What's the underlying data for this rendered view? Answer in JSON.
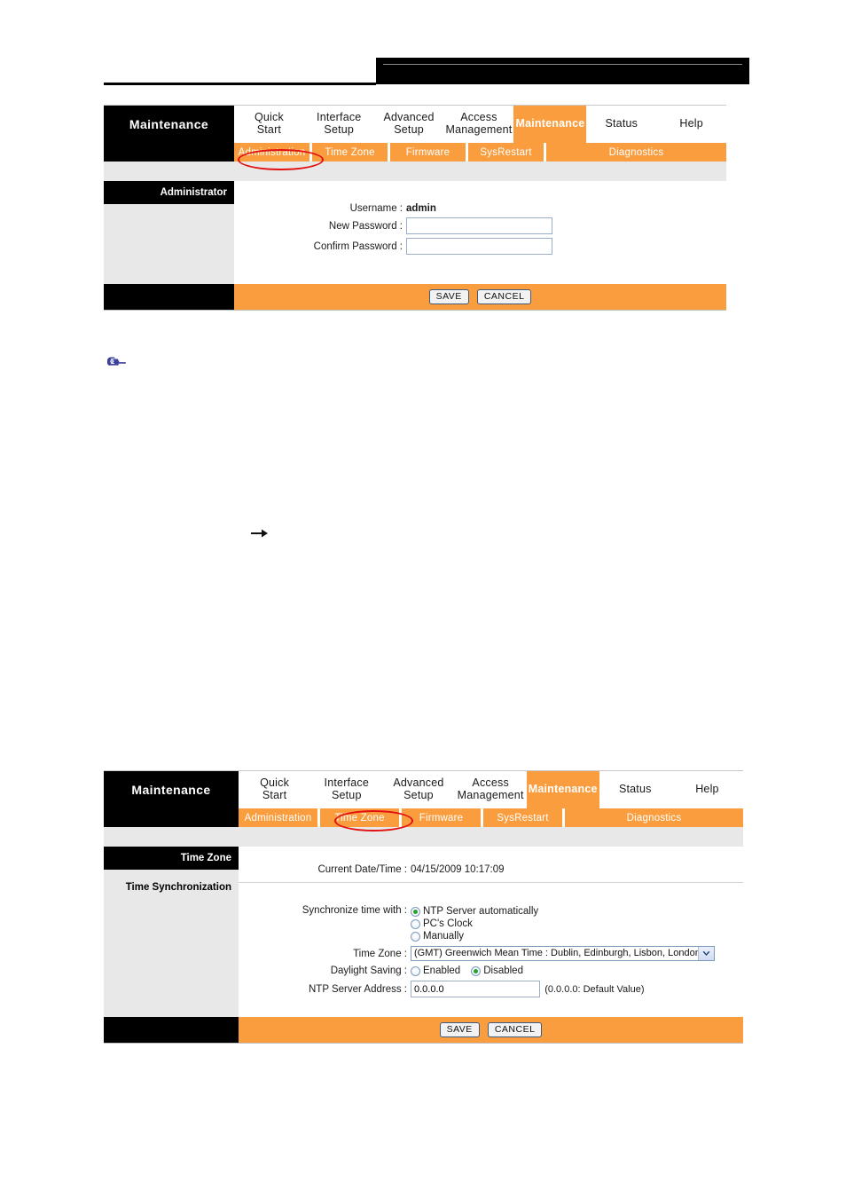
{
  "document": {
    "header_rule": "",
    "hand_icon": "pointing-hand-icon",
    "arrow_icon": "right-arrow-icon"
  },
  "colors": {
    "accent_orange": "#f99d3e",
    "panel_black": "#000000",
    "strip_gray": "#e8e8e8",
    "annotation_red": "#e21111",
    "radio_dot_green": "#2aa22a",
    "input_border_blue": "#9aaec9"
  },
  "panel1": {
    "logo": "Maintenance",
    "main_tabs": [
      {
        "label_line1": "Quick",
        "label_line2": "Start",
        "active": false
      },
      {
        "label_line1": "Interface",
        "label_line2": "Setup",
        "active": false
      },
      {
        "label_line1": "Advanced",
        "label_line2": "Setup",
        "active": false
      },
      {
        "label_line1": "Access",
        "label_line2": "Management",
        "active": false
      },
      {
        "label_line1": "Maintenance",
        "label_line2": "",
        "active": true
      },
      {
        "label_line1": "Status",
        "label_line2": "",
        "active": false
      },
      {
        "label_line1": "Help",
        "label_line2": "",
        "active": false
      }
    ],
    "sub_tabs": [
      {
        "label": "Administration",
        "selected": true
      },
      {
        "label": "Time Zone",
        "selected": false
      },
      {
        "label": "Firmware",
        "selected": false
      },
      {
        "label": "SysRestart",
        "selected": false
      },
      {
        "label": "Diagnostics",
        "selected": false
      }
    ],
    "section_title": "Administrator",
    "fields": {
      "username_label": "Username :",
      "username_value": "admin",
      "new_password_label": "New Password :",
      "new_password_value": "",
      "confirm_password_label": "Confirm Password :",
      "confirm_password_value": ""
    },
    "buttons": {
      "save": "SAVE",
      "cancel": "CANCEL"
    }
  },
  "panel2": {
    "logo": "Maintenance",
    "main_tabs": [
      {
        "label_line1": "Quick",
        "label_line2": "Start",
        "active": false
      },
      {
        "label_line1": "Interface",
        "label_line2": "Setup",
        "active": false
      },
      {
        "label_line1": "Advanced",
        "label_line2": "Setup",
        "active": false
      },
      {
        "label_line1": "Access",
        "label_line2": "Management",
        "active": false
      },
      {
        "label_line1": "Maintenance",
        "label_line2": "",
        "active": true
      },
      {
        "label_line1": "Status",
        "label_line2": "",
        "active": false
      },
      {
        "label_line1": "Help",
        "label_line2": "",
        "active": false
      }
    ],
    "sub_tabs": [
      {
        "label": "Administration",
        "selected": false
      },
      {
        "label": "Time Zone",
        "selected": true
      },
      {
        "label": "Firmware",
        "selected": false
      },
      {
        "label": "SysRestart",
        "selected": false
      },
      {
        "label": "Diagnostics",
        "selected": false
      }
    ],
    "section_title": "Time Zone",
    "section_subtitle": "Time Synchronization",
    "fields": {
      "current_datetime_label": "Current Date/Time :",
      "current_datetime_value": "04/15/2009 10:17:09",
      "sync_label": "Synchronize time with :",
      "sync_options": [
        {
          "label": "NTP Server automatically",
          "checked": true
        },
        {
          "label": "PC's Clock",
          "checked": false
        },
        {
          "label": "Manually",
          "checked": false
        }
      ],
      "timezone_label": "Time Zone :",
      "timezone_value": "(GMT) Greenwich Mean Time : Dublin, Edinburgh, Lisbon, London",
      "daylight_label": "Daylight Saving :",
      "daylight_options": [
        {
          "label": "Enabled",
          "checked": false
        },
        {
          "label": "Disabled",
          "checked": true
        }
      ],
      "ntp_label": "NTP Server Address :",
      "ntp_value": "0.0.0.0",
      "ntp_hint": "(0.0.0.0: Default Value)"
    },
    "buttons": {
      "save": "SAVE",
      "cancel": "CANCEL"
    }
  }
}
